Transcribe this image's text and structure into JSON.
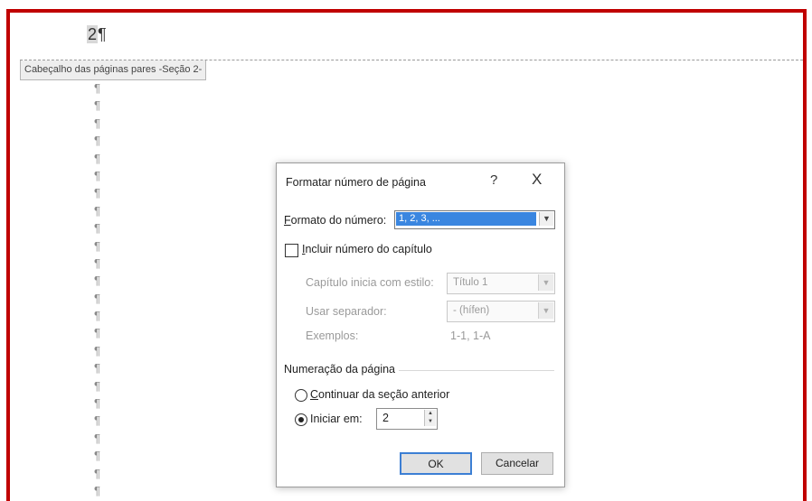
{
  "document": {
    "page_number": "2",
    "header_paragraph_mark": "¶",
    "header_tag": "Cabeçalho das páginas pares -Seção 2-",
    "paragraph_mark": "¶",
    "paragraph_count": 24
  },
  "dialog": {
    "title": "Formatar número de página",
    "help_glyph": "?",
    "close_glyph": "X",
    "number_format_label": "Formato do número:",
    "number_format_value": "1, 2, 3, ...",
    "include_chapter_label": "Incluir número do capítulo",
    "include_chapter_checked": false,
    "chapter_style_label": "Capítulo inicia com estilo:",
    "chapter_style_value": "Título 1",
    "separator_label": "Usar separador:",
    "separator_value": "-   (hífen)",
    "examples_label": "Exemplos:",
    "examples_value": "1-1, 1-A",
    "page_numbering_label": "Numeração da página",
    "continue_label": "Continuar da seção anterior",
    "start_at_label": "Iniciar em:",
    "start_at_value": "2",
    "selected_numbering": "start_at",
    "ok_label": "OK",
    "cancel_label": "Cancelar"
  },
  "colors": {
    "frame_border": "#c00000",
    "selection_highlight": "#3a86e0",
    "ok_border": "#3c7fd4"
  },
  "icons": {
    "dropdown": "chevron-down-icon",
    "spinner_up": "caret-up-icon",
    "spinner_down": "caret-down-icon"
  }
}
